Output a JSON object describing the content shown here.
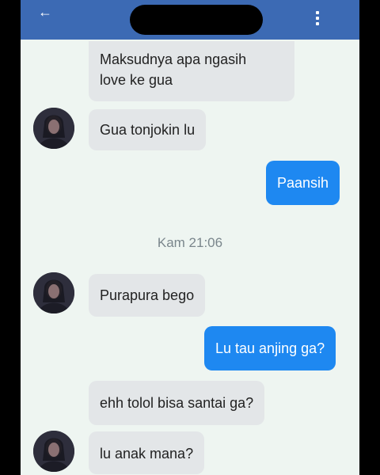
{
  "header": {
    "back_icon": "arrow-left-icon",
    "menu_icon": "more-vertical-icon"
  },
  "messages": [
    {
      "direction": "incoming",
      "lines": [
        "Maksudnya apa ngasih",
        "love ke gua"
      ]
    },
    {
      "direction": "incoming",
      "text": "Gua tonjokin lu",
      "avatar": true
    },
    {
      "direction": "outgoing",
      "text": "Paansih"
    },
    {
      "direction": "incoming",
      "text": "Purapura bego",
      "avatar": true
    },
    {
      "direction": "outgoing",
      "text": "Lu tau anjing ga?"
    },
    {
      "direction": "incoming",
      "text": "ehh tolol bisa santai ga?"
    },
    {
      "direction": "incoming",
      "text": "lu anak mana?",
      "avatar": true
    }
  ],
  "timestamp": "Kam 21:06",
  "colors": {
    "appbar": "#3c6ab4",
    "outgoing_bubble": "#1e88f1",
    "incoming_bubble": "#e3e6e8",
    "background": "#eef5f1"
  }
}
